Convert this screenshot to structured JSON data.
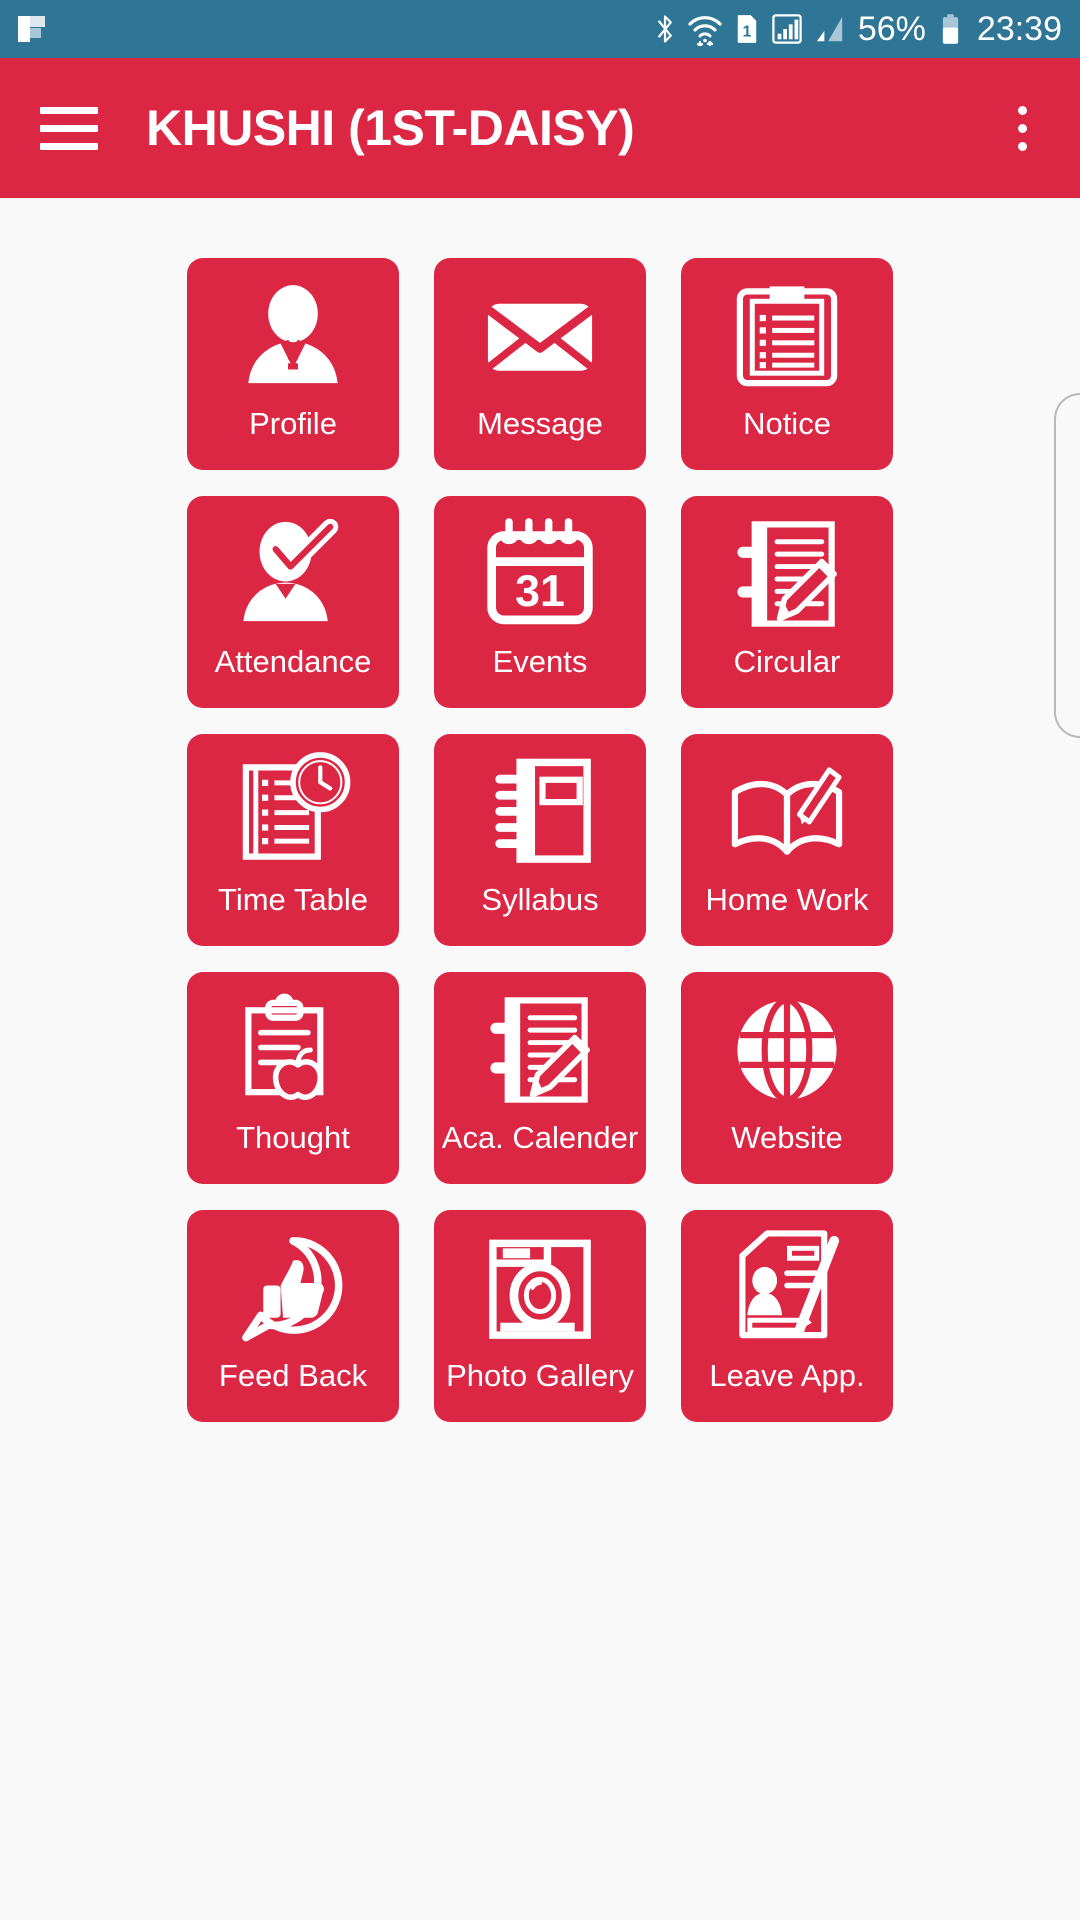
{
  "status_bar": {
    "background_color": "#2e7596",
    "notification_icon": "flipboard-icon",
    "icons": [
      "bluetooth-icon",
      "wifi-icon",
      "sim-card-1-icon",
      "signal-bars-boxed-icon",
      "signal-bars-icon"
    ],
    "battery_percent": "56%",
    "battery_icon": "battery-icon",
    "clock": "23:39"
  },
  "app_bar": {
    "background_color": "#dc2744",
    "menu_icon": "hamburger-menu-icon",
    "title": "KHUSHI (1ST-DAISY)",
    "overflow_icon": "three-dot-overflow-icon"
  },
  "content": {
    "background_color": "#f9f9fa",
    "tile_color": "#dc2744",
    "tiles": [
      {
        "label": "Profile",
        "icon": "person-tie-icon"
      },
      {
        "label": "Message",
        "icon": "envelope-icon"
      },
      {
        "label": "Notice",
        "icon": "clipboard-list-icon"
      },
      {
        "label": "Attendance",
        "icon": "person-check-icon"
      },
      {
        "label": "Events",
        "icon": "calendar-31-icon",
        "icon_text": "31"
      },
      {
        "label": "Circular",
        "icon": "notebook-pencil-icon"
      },
      {
        "label": "Time Table",
        "icon": "list-clock-icon"
      },
      {
        "label": "Syllabus",
        "icon": "spiral-book-icon"
      },
      {
        "label": "Home Work",
        "icon": "open-book-pencil-icon"
      },
      {
        "label": "Thought",
        "icon": "clipboard-apple-icon"
      },
      {
        "label": "Aca. Calender",
        "icon": "notebook-pencil-icon"
      },
      {
        "label": "Website",
        "icon": "globe-icon"
      },
      {
        "label": "Feed Back",
        "icon": "thumbs-up-bubble-icon"
      },
      {
        "label": "Photo Gallery",
        "icon": "camera-icon"
      },
      {
        "label": "Leave App.",
        "icon": "leave-application-icon"
      }
    ]
  },
  "scrollbar": {
    "visible": true
  }
}
